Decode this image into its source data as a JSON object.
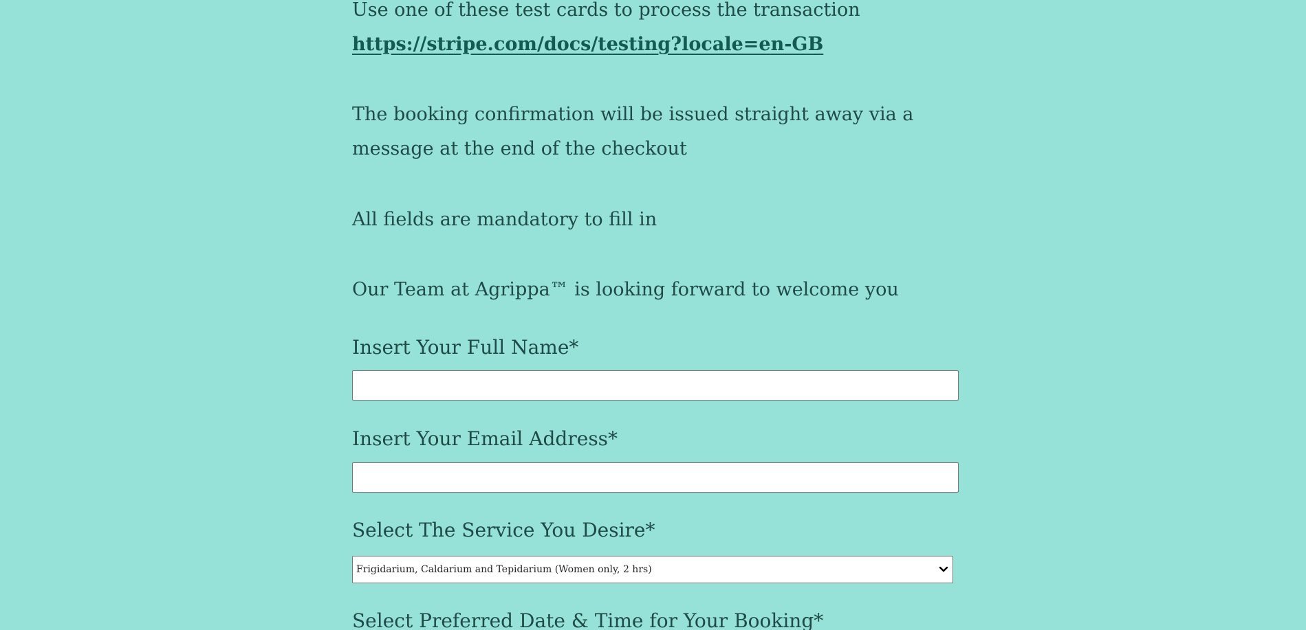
{
  "intro": {
    "test_cards_text": "Use one of these test cards to process the transaction",
    "test_cards_link": "https://stripe.com/docs/testing?locale=en-GB",
    "confirmation_text": "The booking confirmation will be issued straight away via a message at the end of the checkout",
    "mandatory_text": "All fields are mandatory to fill in",
    "welcome_text": "Our Team at Agrippa™ is looking forward to welcome you"
  },
  "form": {
    "full_name_label": "Insert Your Full Name*",
    "full_name_value": "",
    "email_label": "Insert Your Email Address*",
    "email_value": "",
    "service_label": "Select The Service You Desire*",
    "service_selected": "Frigidarium, Caldarium and Tepidarium (Women only, 2 hrs)",
    "datetime_label": "Select Preferred Date & Time for Your Booking*"
  },
  "colors": {
    "background": "#96e2d9",
    "text": "#1f4a46",
    "link": "#145a52"
  },
  "icons": {
    "select_arrow": "chevron-down-icon"
  }
}
